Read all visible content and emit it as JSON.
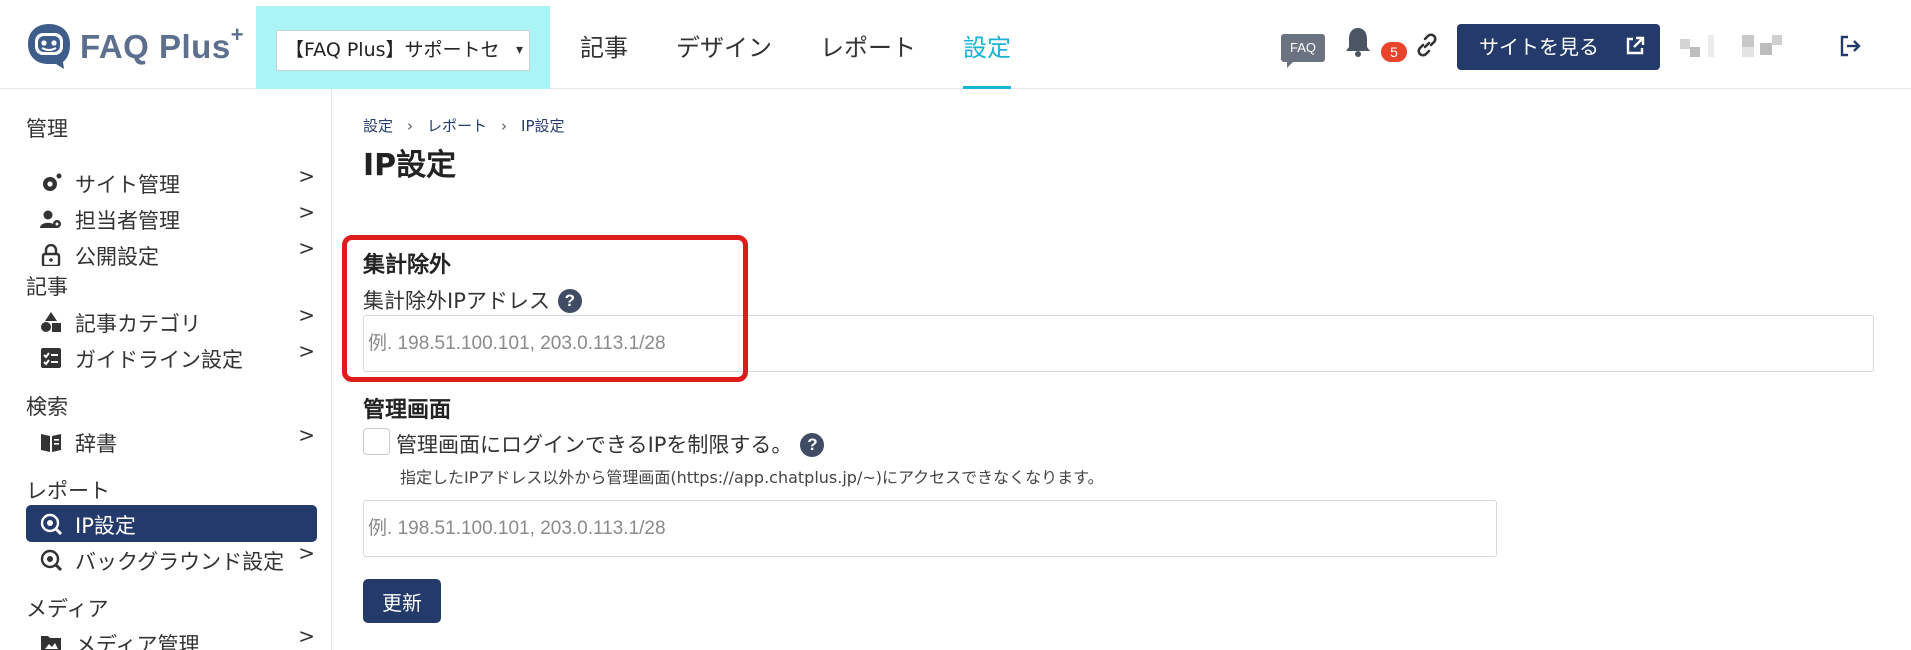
{
  "header": {
    "logo_text": "FAQ Plus",
    "logo_sup": "+",
    "site_select": "【FAQ Plus】サポートセ",
    "nav": [
      "記事",
      "デザイン",
      "レポート",
      "設定"
    ],
    "active_nav": "設定",
    "faq_icon_text": "FAQ",
    "notification_count": "5",
    "view_site_label": "サイトを見る"
  },
  "sidebar": {
    "groups": {
      "admin": "管理",
      "article": "記事",
      "search": "検索",
      "report": "レポート",
      "media": "メディア"
    },
    "items": [
      {
        "label": "サイト管理",
        "icon": "gear-icon"
      },
      {
        "label": "担当者管理",
        "icon": "user-gear-icon"
      },
      {
        "label": "公開設定",
        "icon": "lock-icon"
      },
      {
        "label": "記事カテゴリ",
        "icon": "shapes-icon"
      },
      {
        "label": "ガイドライン設定",
        "icon": "checklist-icon"
      },
      {
        "label": "辞書",
        "icon": "book-icon"
      },
      {
        "label": "IP設定",
        "icon": "ip-search-icon",
        "active": true
      },
      {
        "label": "バックグラウンド設定",
        "icon": "background-search-icon"
      },
      {
        "label": "メディア管理",
        "icon": "media-folder-icon"
      }
    ],
    "chevron": ">"
  },
  "main": {
    "breadcrumb": [
      "設定",
      "レポート",
      "IP設定"
    ],
    "breadcrumb_sep": "›",
    "title": "IP設定",
    "exclusion": {
      "section_title": "集計除外",
      "field_label": "集計除外IPアドレス",
      "placeholder": "例. 198.51.100.101, 203.0.113.1/28"
    },
    "admin": {
      "section_title": "管理画面",
      "checkbox_label": "管理画面にログインできるIPを制限する。",
      "checkbox_checked": false,
      "note": "指定したIPアドレス以外から管理画面(https://app.chatplus.jp/~)にアクセスできなくなります。",
      "placeholder": "例. 198.51.100.101, 203.0.113.1/28"
    },
    "help_glyph": "?",
    "update_label": "更新"
  },
  "colors": {
    "navy": "#243a6b",
    "accent": "#19b3d6",
    "badge": "#e8452c",
    "highlight": "#dd1c1c",
    "site_select_bg": "#a9f5f5"
  }
}
